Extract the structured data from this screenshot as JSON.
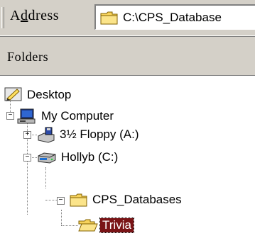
{
  "address_bar": {
    "label_prefix": "A",
    "label_underlined": "d",
    "label_suffix": "dress",
    "value": "C:\\CPS_Database"
  },
  "folders_pane": {
    "title": "Folders",
    "close_glyph": "×"
  },
  "tree": {
    "desktop": "Desktop",
    "my_computer": "My Computer",
    "floppy": "3½ Floppy (A:)",
    "drive_c": "Hollyb (C:)",
    "cps_databases": "CPS_Databases",
    "trivia": "Trivia"
  },
  "colors": {
    "chrome": "#d4d0c8",
    "selection": "#7a1416",
    "folder_yellow": "#f7d35c"
  }
}
